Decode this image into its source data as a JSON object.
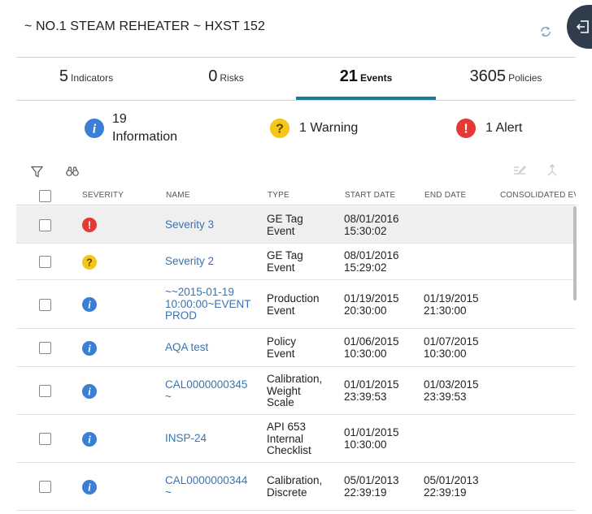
{
  "header": {
    "title": "~ NO.1 STEAM REHEATER ~ HXST 152"
  },
  "tabs": [
    {
      "count": "5",
      "label": "Indicators"
    },
    {
      "count": "0",
      "label": "Risks"
    },
    {
      "count": "21",
      "label": "Events"
    },
    {
      "count": "3605",
      "label": "Policies"
    }
  ],
  "summary": {
    "information": {
      "count": "19",
      "label": "Information"
    },
    "warning": {
      "label": "1 Warning"
    },
    "alert": {
      "label": "1 Alert"
    }
  },
  "colors": {
    "info": "#3b7fd4",
    "warning": "#f5c518",
    "alert": "#e53935",
    "accent": "#1d7898",
    "link": "#3b73b0"
  },
  "table": {
    "columns": {
      "severity": "SEVERITY",
      "name": "NAME",
      "type": "TYPE",
      "start": "START DATE",
      "end": "END DATE",
      "consolidated": "CONSOLIDATED EV"
    },
    "rows": [
      {
        "severity": "alert",
        "name": [
          "Severity 3"
        ],
        "type": [
          "GE Tag",
          "Event"
        ],
        "start": [
          "08/01/2016",
          "15:30:02"
        ],
        "end": [],
        "selected": true
      },
      {
        "severity": "warning",
        "name": [
          "Severity 2"
        ],
        "type": [
          "GE Tag",
          "Event"
        ],
        "start": [
          "08/01/2016",
          "15:29:02"
        ],
        "end": []
      },
      {
        "severity": "info",
        "name": [
          "~~2015-01-19",
          "10:00:00~EVENT",
          "PROD"
        ],
        "type": [
          "Production",
          "Event"
        ],
        "start": [
          "01/19/2015",
          "20:30:00"
        ],
        "end": [
          "01/19/2015",
          "21:30:00"
        ]
      },
      {
        "severity": "info",
        "name": [
          "AQA test"
        ],
        "type": [
          "Policy",
          "Event"
        ],
        "start": [
          "01/06/2015",
          "10:30:00"
        ],
        "end": [
          "01/07/2015",
          "10:30:00"
        ]
      },
      {
        "severity": "info",
        "name": [
          "CAL0000000345",
          "~"
        ],
        "type": [
          "Calibration,",
          "Weight",
          "Scale"
        ],
        "start": [
          "01/01/2015",
          "23:39:53"
        ],
        "end": [
          "01/03/2015",
          "23:39:53"
        ]
      },
      {
        "severity": "info",
        "name": [
          "INSP-24"
        ],
        "type": [
          "API 653",
          "Internal",
          "Checklist"
        ],
        "start": [
          "01/01/2015",
          "10:30:00"
        ],
        "end": []
      },
      {
        "severity": "info",
        "name": [
          "CAL0000000344",
          "~"
        ],
        "type": [
          "Calibration,",
          "Discrete"
        ],
        "start": [
          "05/01/2013",
          "22:39:19"
        ],
        "end": [
          "05/01/2013",
          "22:39:19"
        ]
      }
    ]
  }
}
